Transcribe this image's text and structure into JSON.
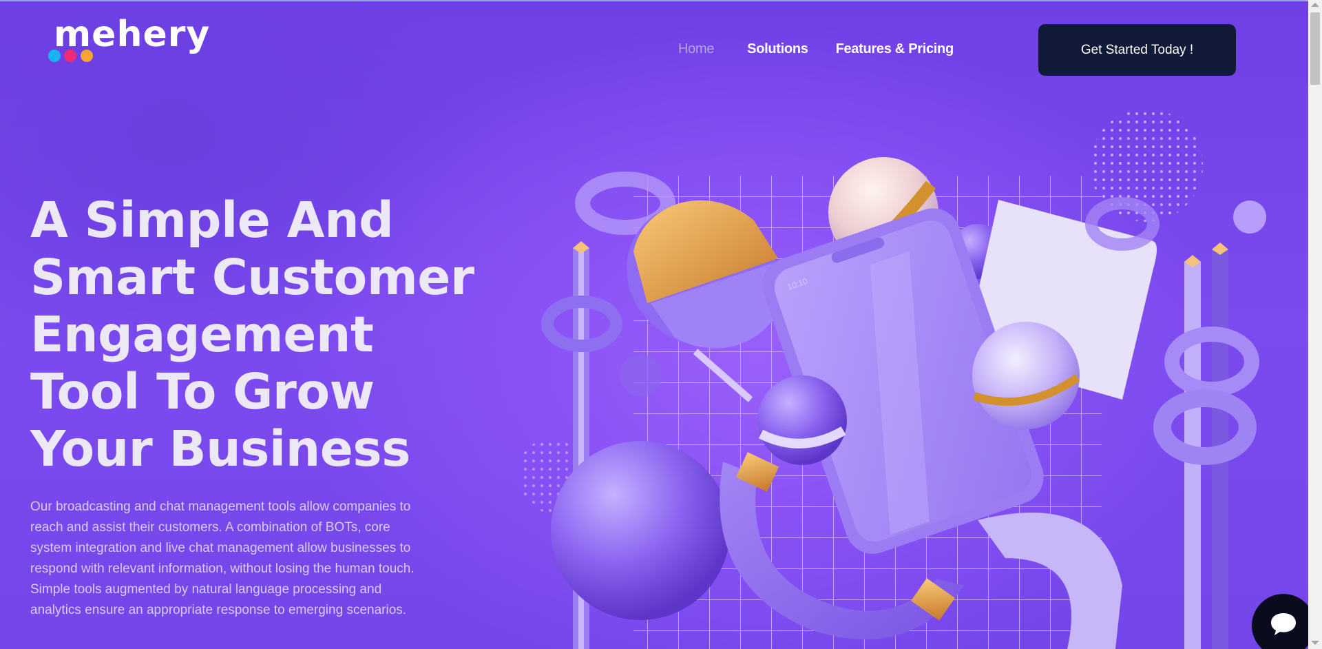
{
  "brand": {
    "name": "mehery",
    "dot_colors": [
      "#18b4f2",
      "#ee2b74",
      "#f7a536"
    ]
  },
  "nav": {
    "items": [
      {
        "label": "Home",
        "active": true
      },
      {
        "label": "Solutions",
        "active": false
      },
      {
        "label": "Features & Pricing",
        "active": false
      }
    ],
    "cta_label": "Get Started Today !"
  },
  "hero": {
    "title": "A Simple And Smart Customer Engagement Tool To Grow Your Business",
    "description": "Our broadcasting and chat management tools allow companies to reach and assist their customers.  A combination of BOTs, core system integration and live chat management allow businesses to respond with relevant information, without losing the human touch. Simple tools augmented by natural language processing and analytics ensure an appropriate response to emerging scenarios."
  },
  "phone": {
    "time": "10:10"
  },
  "chat_widget": {
    "icon": "chat-bubble-icon"
  },
  "colors": {
    "background": "#7747ec",
    "cta_bg": "#121a3a",
    "title_text": "#ece8f5",
    "chat_button": "#0b0b1e"
  }
}
